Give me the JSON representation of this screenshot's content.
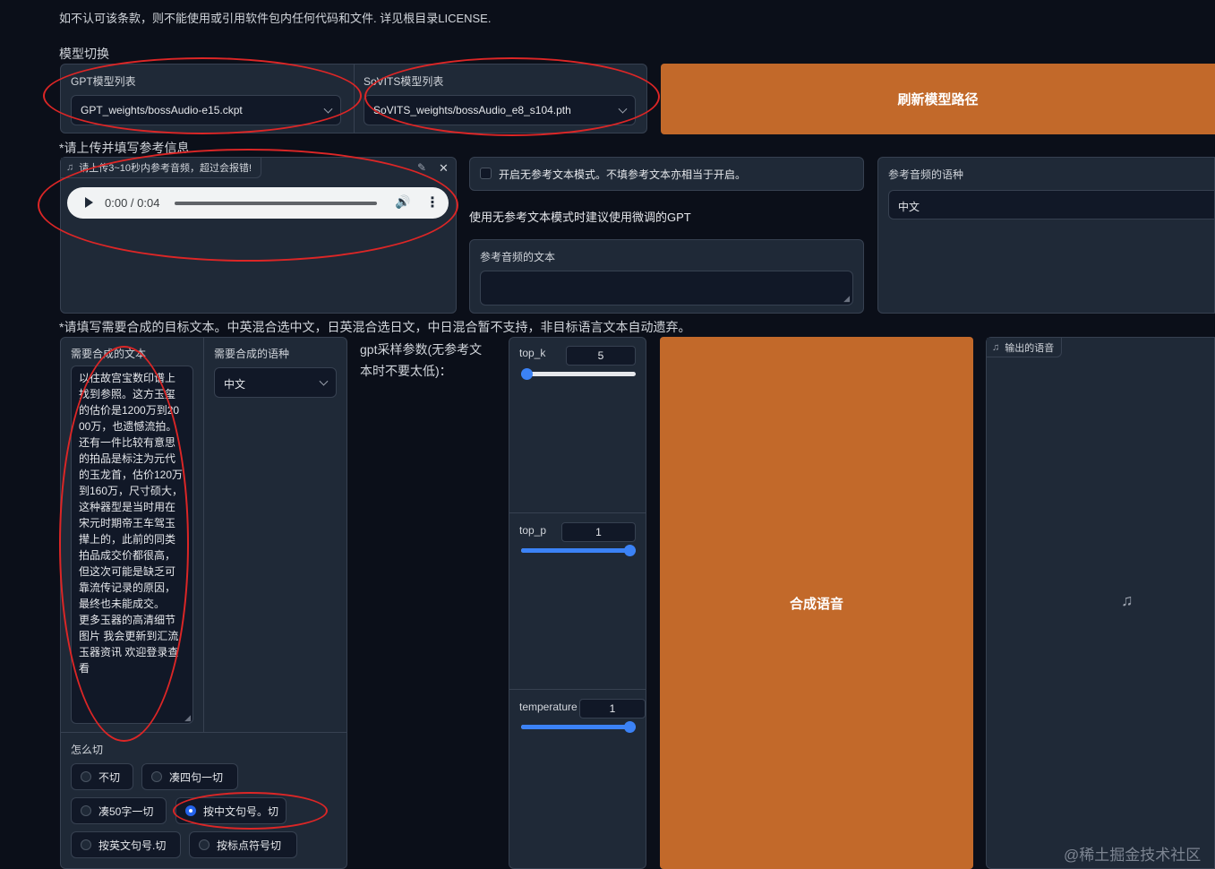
{
  "license_notice": "如不认可该条款，则不能使用或引用软件包内任何代码和文件. 详见根目录LICENSE.",
  "model_switch": {
    "title": "模型切换",
    "gpt_label": "GPT模型列表",
    "gpt_value": "GPT_weights/bossAudio-e15.ckpt",
    "sovits_label": "SoVITS模型列表",
    "sovits_value": "SoVITS_weights/bossAudio_e8_s104.pth",
    "refresh_button": "刷新模型路径"
  },
  "reference": {
    "section_title": "*请上传并填写参考信息",
    "audio_label": "请上传3~10秒内参考音频，超过会报错!",
    "audio_time": "0:00 / 0:04",
    "no_ref_checkbox_label": "开启无参考文本模式。不填参考文本亦相当于开启。",
    "no_ref_hint": "使用无参考文本模式时建议使用微调的GPT",
    "ref_text_label": "参考音频的文本",
    "ref_text_value": "",
    "ref_lang_label": "参考音频的语种",
    "ref_lang_value": "中文"
  },
  "synthesis": {
    "section_title": "*请填写需要合成的目标文本。中英混合选中文，日英混合选日文，中日混合暂不支持，非目标语言文本自动遗弃。",
    "target_text_label": "需要合成的文本",
    "target_text_value": "以往故宫宝数印谱上找到参照。这方玉玺的估价是1200万到2000万，也遗憾流拍。\n还有一件比较有意思的拍品是标注为元代的玉龙首，估价120万到160万，尺寸硕大，这种器型是当时用在宋元时期帝王车驾玉撵上的，此前的同类拍品成交价都很高，但这次可能是缺乏可靠流传记录的原因，最终也未能成交。\n更多玉器的高清细节图片 我会更新到汇流玉器资讯 欢迎登录查看",
    "target_lang_label": "需要合成的语种",
    "target_lang_value": "中文",
    "gpt_params_label": "gpt采样参数(无参考文本时不要太低)：",
    "top_k_label": "top_k",
    "top_k_value": "5",
    "top_k_fraction": 0.04,
    "top_p_label": "top_p",
    "top_p_value": "1",
    "top_p_fraction": 1.0,
    "temperature_label": "temperature",
    "temperature_value": "1",
    "temperature_fraction": 1.0,
    "synth_button": "合成语音",
    "output_label": "输出的语音",
    "cut_label": "怎么切",
    "cut_options": [
      "不切",
      "凑四句一切",
      "凑50字一切",
      "按中文句号。切",
      "按英文句号.切",
      "按标点符号切"
    ],
    "cut_selected": 3
  },
  "watermark": "@稀土掘金技术社区",
  "colors": {
    "accent": "#c2692a",
    "annotation": "#dc2626",
    "slider": "#3b82f6"
  }
}
